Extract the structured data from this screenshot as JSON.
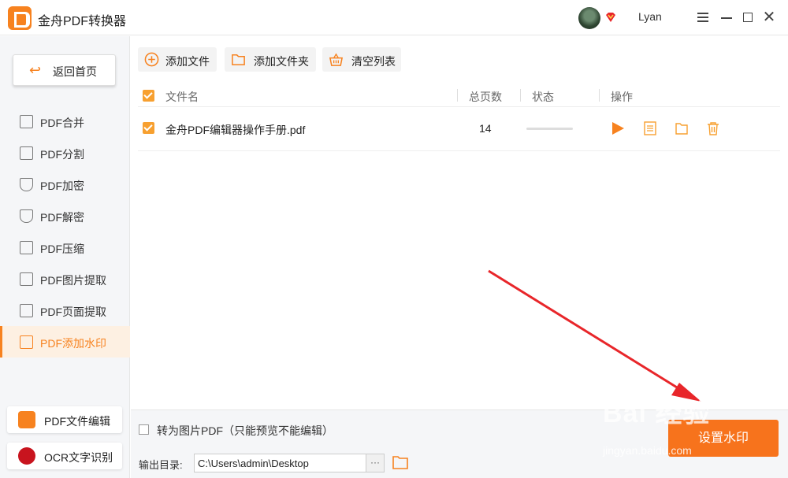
{
  "app": {
    "title": "金舟PDF转换器",
    "username": "Lyan"
  },
  "sidebar": {
    "back_label": "返回首页",
    "items": [
      {
        "label": "PDF合并",
        "icon": "merge-icon"
      },
      {
        "label": "PDF分割",
        "icon": "split-icon"
      },
      {
        "label": "PDF加密",
        "icon": "encrypt-icon"
      },
      {
        "label": "PDF解密",
        "icon": "decrypt-icon"
      },
      {
        "label": "PDF压缩",
        "icon": "compress-icon"
      },
      {
        "label": "PDF图片提取",
        "icon": "image-extract-icon"
      },
      {
        "label": "PDF页面提取",
        "icon": "page-extract-icon"
      },
      {
        "label": "PDF添加水印",
        "icon": "watermark-icon",
        "active": true
      }
    ],
    "apps": [
      {
        "label": "PDF文件编辑",
        "icon": "pdf-editor-icon"
      },
      {
        "label": "OCR文字识别",
        "icon": "ocr-icon"
      }
    ]
  },
  "toolbar": {
    "add_file": "添加文件",
    "add_folder": "添加文件夹",
    "clear_list": "清空列表"
  },
  "table": {
    "headers": {
      "name": "文件名",
      "pages": "总页数",
      "status": "状态",
      "actions": "操作"
    },
    "rows": [
      {
        "name": "金舟PDF编辑器操作手册.pdf",
        "pages": "14",
        "checked": true,
        "progress": 0
      }
    ]
  },
  "bottom": {
    "convert_option": "转为图片PDF（只能预览不能编辑）",
    "output_label": "输出目录:",
    "output_path": "C:\\Users\\admin\\Desktop",
    "more": "···",
    "primary_button": "设置水印"
  },
  "overlay": {
    "watermark_text": "Bai 经验",
    "watermark_url": "jingyan.baidu.com"
  },
  "colors": {
    "accent": "#f7821f",
    "primary_button": "#f7731c",
    "arrow": "#e8262a"
  }
}
